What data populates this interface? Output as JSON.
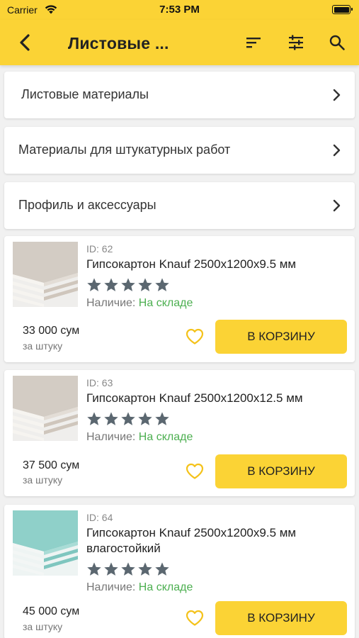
{
  "status_bar": {
    "carrier": "Carrier",
    "time": "7:53 PM"
  },
  "app_bar": {
    "title": "Листовые ...",
    "back_icon": "chevron-left-icon",
    "actions": [
      "sort-icon",
      "filter-sliders-icon",
      "search-icon"
    ]
  },
  "categories": [
    {
      "label": "Листовые материалы"
    },
    {
      "label": "Материалы для штукатурных работ"
    },
    {
      "label": "Профиль и аксессуары"
    }
  ],
  "products": [
    {
      "id_label": "ID: 62",
      "name": "Гипсокартон Knauf 2500x1200x9.5 мм",
      "rating": 5,
      "availability_label": "Наличие:",
      "availability_value": "На складе",
      "price": "33 000 сум",
      "unit": "за штуку",
      "cart_label": "В КОРЗИНУ",
      "thumb_color": "#d3ccc4"
    },
    {
      "id_label": "ID: 63",
      "name": "Гипсокартон Knauf 2500x1200x12.5 мм",
      "rating": 5,
      "availability_label": "Наличие:",
      "availability_value": "На складе",
      "price": "37 500 сум",
      "unit": "за штуку",
      "cart_label": "В КОРЗИНУ",
      "thumb_color": "#d3ccc4"
    },
    {
      "id_label": "ID: 64",
      "name": "Гипсокартон Knauf 2500x1200x9.5 мм влагостойкий",
      "rating": 5,
      "availability_label": "Наличие:",
      "availability_value": "На складе",
      "price": "45 000 сум",
      "unit": "за штуку",
      "cart_label": "В КОРЗИНУ",
      "thumb_color": "#8fd0c9"
    }
  ],
  "colors": {
    "accent": "#fbd335",
    "in_stock": "#4caf50",
    "star": "#5b6770",
    "heart": "#f4c21a"
  }
}
